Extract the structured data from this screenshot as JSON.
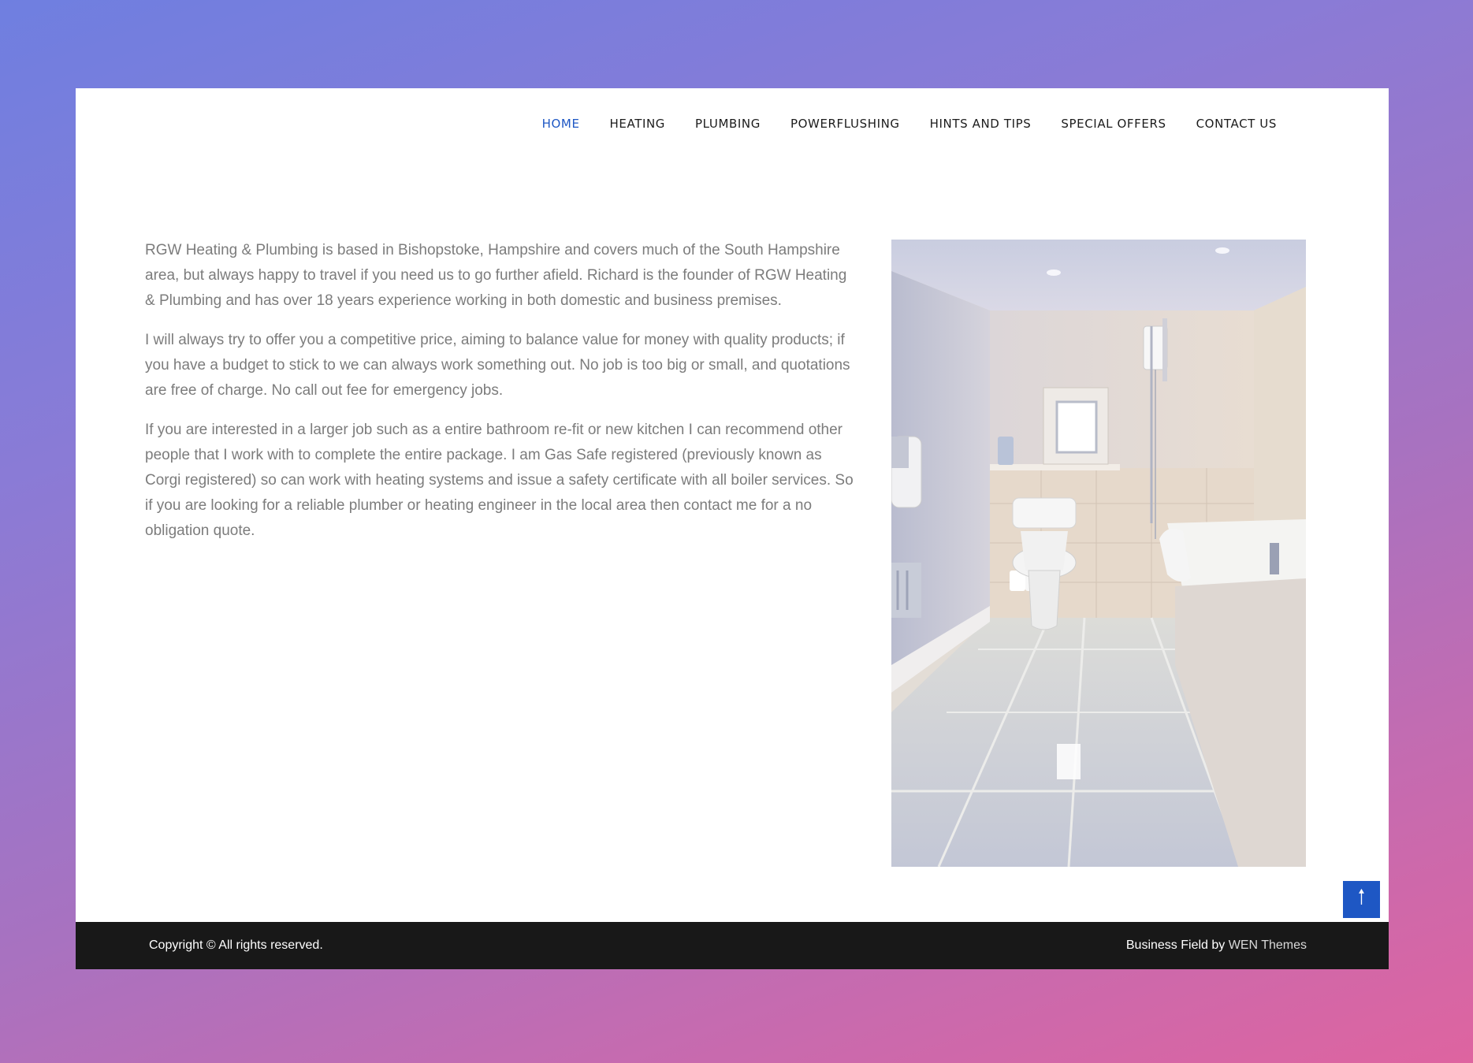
{
  "nav": {
    "items": [
      {
        "label": "HOME",
        "active": true
      },
      {
        "label": "HEATING"
      },
      {
        "label": "PLUMBING"
      },
      {
        "label": "POWERFLUSHING"
      },
      {
        "label": "HINTS AND TIPS"
      },
      {
        "label": "SPECIAL OFFERS"
      },
      {
        "label": "CONTACT US"
      }
    ]
  },
  "main": {
    "paragraphs": [
      "RGW Heating & Plumbing is based in Bishopstoke, Hampshire and covers much of the South Hampshire area, but always happy to travel if you need us to go further afield. Richard is the founder of RGW Heating & Plumbing and has over 18 years experience working in both domestic and business premises.",
      "I will always try to offer you a competitive price, aiming to balance value for money with quality products; if you have a budget to stick to we can always work something out. No job is too big or small, and quotations are free of charge. No call out fee for emergency jobs.",
      "If you are interested in a larger job such as a entire bathroom re-fit or new kitchen I can recommend other people that I work with to complete the entire package. I am Gas Safe registered (previously known as Corgi registered) so can work with heating systems and issue a safety certificate with all boiler services. So if you are looking for a reliable plumber or heating engineer in the local area then contact me for a no obligation quote."
    ]
  },
  "footer": {
    "copyright": "Copyright © All rights reserved.",
    "credit_prefix": "Business Field by ",
    "credit_link": "WEN Themes"
  },
  "scroll_top": {
    "icon": "arrow-up-icon",
    "glyph": "🠑"
  },
  "colors": {
    "accent": "#1e57c4",
    "footer_bg": "#181818",
    "text": "#7c7c7c"
  }
}
